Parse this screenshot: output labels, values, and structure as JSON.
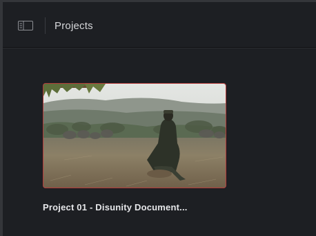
{
  "header": {
    "title": "Projects",
    "sidebar_toggle_icon": "sidebar-panel-icon"
  },
  "projects": [
    {
      "name": "Project 01 - Disunity Document...",
      "thumbnail": "man-sitting-in-savanna-with-elephants",
      "selected": true
    }
  ],
  "colors": {
    "background": "#1d1f23",
    "selection_border": "#b63a3a",
    "text": "#e6e7ea"
  }
}
